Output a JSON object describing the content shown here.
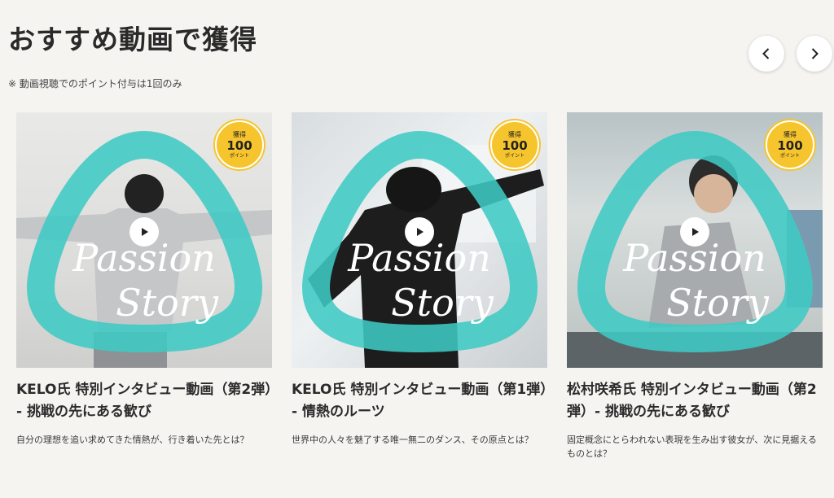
{
  "header": {
    "title": "おすすめ動画で獲得",
    "notice": "※ 動画視聴でのポイント付与は1回のみ"
  },
  "nav": {
    "prev_icon": "chevron-left-icon",
    "next_icon": "chevron-right-icon"
  },
  "badge": {
    "top": "獲得",
    "points": "100",
    "unit": "ポイント"
  },
  "overlay_text": {
    "line1": "Passion",
    "line2": "Story"
  },
  "colors": {
    "accent_teal": "#3fc9c4",
    "badge_yellow": "#f6c42d",
    "background": "#f5f4f1"
  },
  "videos": [
    {
      "title": "KELO氏 特別インタビュー動画（第2弾）",
      "subtitle": "- 挑戦の先にある歓び",
      "description": "自分の理想を追い求めてきた情熱が、行き着いた先とは？"
    },
    {
      "title": "KELO氏 特別インタビュー動画（第1弾）",
      "subtitle": "- 情熱のルーツ",
      "description": "世界中の人々を魅了する唯一無二のダンス、その原点とは？"
    },
    {
      "title": "松村咲希氏 特別インタビュー動画（第2弾）- 挑戦の先にある歓び",
      "subtitle": "",
      "description": "固定概念にとらわれない表現を生み出す彼女が、次に見据えるものとは？"
    }
  ]
}
